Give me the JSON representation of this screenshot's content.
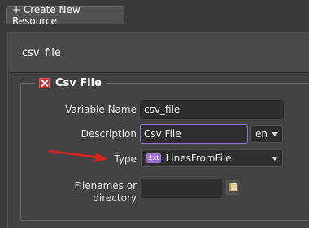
{
  "toolbar": {
    "create_label": "+ Create New Resource"
  },
  "resource": {
    "name": "csv_file"
  },
  "section": {
    "title": "Csv File"
  },
  "fields": {
    "variable_name": {
      "label": "Variable Name",
      "value": "csv_file"
    },
    "description": {
      "label": "Description",
      "value": "Csv File",
      "language": "en"
    },
    "type": {
      "label": "Type",
      "badge": ".txt",
      "value": "LinesFromFile"
    },
    "filenames": {
      "label_line1": "Filenames or",
      "label_line2": "directory",
      "value": ""
    }
  },
  "colors": {
    "focus_border": "#9470c7",
    "remove_icon": "#c62d2d",
    "annotation_arrow": "#e0211c",
    "txt_badge": "#9b6fd6"
  }
}
